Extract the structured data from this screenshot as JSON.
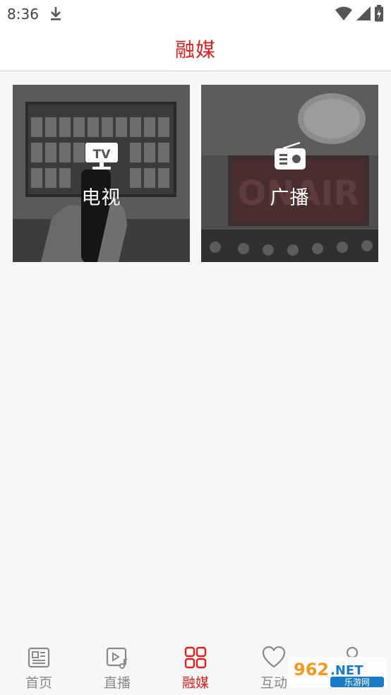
{
  "status_bar": {
    "time": "8:36",
    "icons": [
      "download-icon",
      "wifi-icon",
      "signal-icon",
      "battery-charging-icon"
    ]
  },
  "header": {
    "title": "融媒",
    "title_color": "#e0201f"
  },
  "tiles": [
    {
      "label": "电视",
      "icon": "tv-icon",
      "icon_text": "TV"
    },
    {
      "label": "广播",
      "icon": "radio-icon"
    }
  ],
  "tab_bar": {
    "active_color": "#e0201f",
    "inactive_color": "#8a8a8a",
    "items": [
      {
        "label": "首页",
        "icon": "news-icon",
        "active": false
      },
      {
        "label": "直播",
        "icon": "video-music-icon",
        "active": false
      },
      {
        "label": "融媒",
        "icon": "grid-icon",
        "active": true
      },
      {
        "label": "互动",
        "icon": "heart-icon",
        "active": false
      }
    ]
  },
  "watermark": {
    "number": "962",
    "suffix": ".NET",
    "caption": "乐游网"
  }
}
